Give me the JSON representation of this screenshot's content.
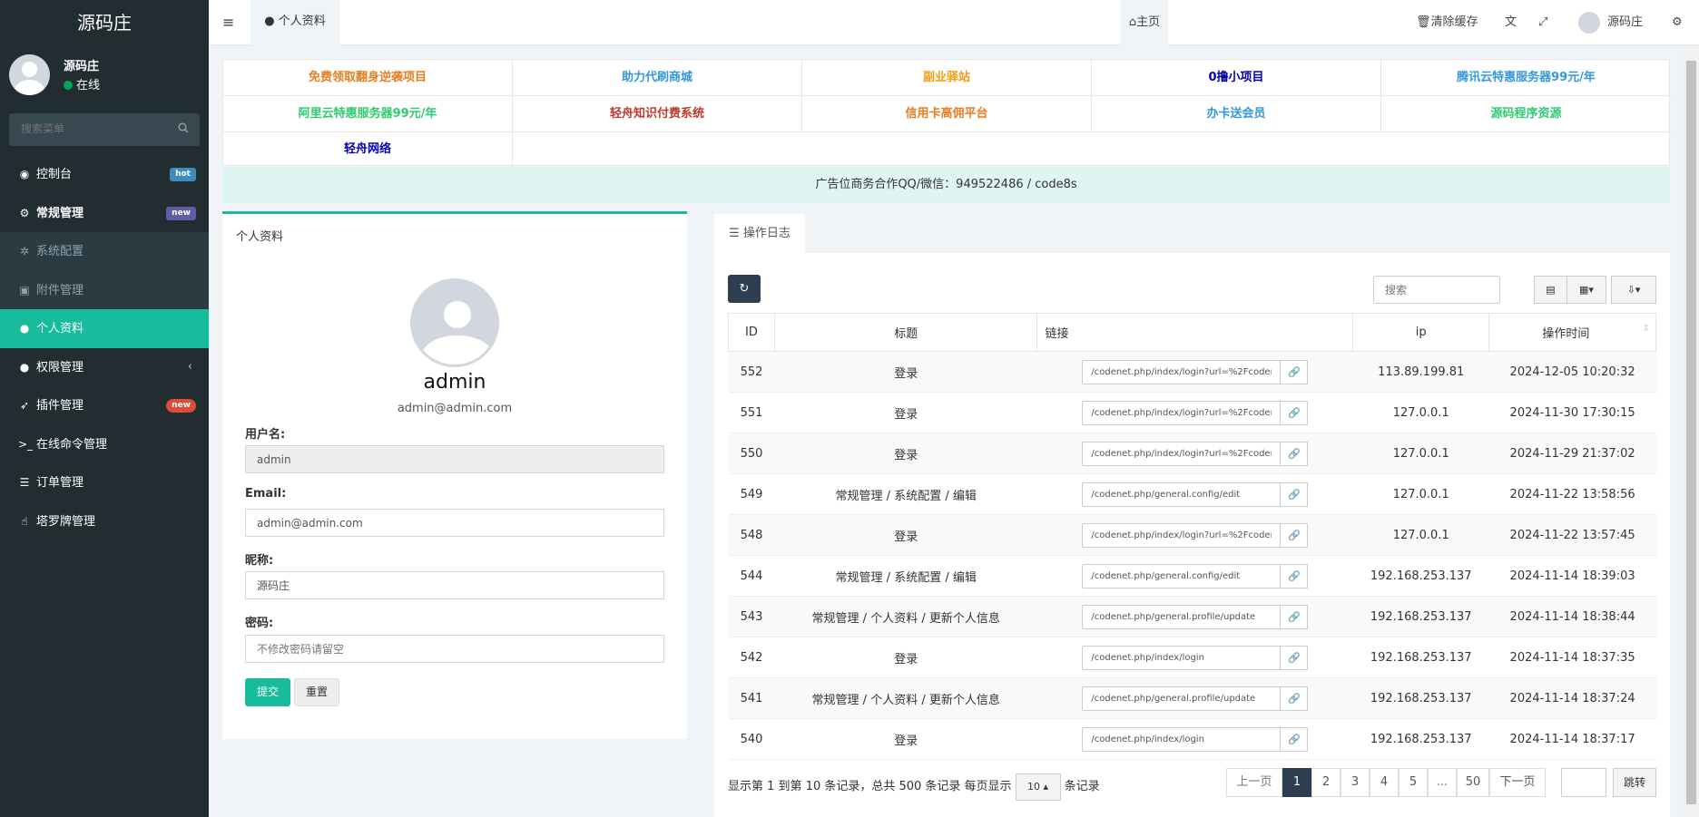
{
  "app": {
    "logo": "源码庄"
  },
  "user": {
    "name": "源码庄",
    "status": "在线"
  },
  "sidebar": {
    "search_placeholder": "搜索菜单",
    "items": [
      {
        "icon": "dashboard-icon",
        "glyph": "◉",
        "label": "控制台",
        "badge": "hot",
        "badge_color": "#3c8dbc"
      },
      {
        "icon": "cogs-icon",
        "glyph": "⚙",
        "label": "常规管理",
        "badge": "new",
        "badge_color": "#605ca8"
      },
      {
        "icon": "gear-icon",
        "glyph": "✲",
        "label": "系统配置"
      },
      {
        "icon": "image-icon",
        "glyph": "▣",
        "label": "附件管理"
      },
      {
        "icon": "user-icon",
        "glyph": "●",
        "label": "个人资料"
      },
      {
        "icon": "group-icon",
        "glyph": "●",
        "label": "权限管理"
      },
      {
        "icon": "rocket-icon",
        "glyph": "➶",
        "label": "插件管理",
        "badge": "new",
        "badge_color": "#dd4b39"
      },
      {
        "icon": "terminal-icon",
        "glyph": ">_",
        "label": "在线命令管理"
      },
      {
        "icon": "list-icon",
        "glyph": "☰",
        "label": "订单管理"
      },
      {
        "icon": "hand-icon",
        "glyph": "☝",
        "label": "塔罗牌管理"
      }
    ]
  },
  "header": {
    "active_tab": "个人资料",
    "home": "主页",
    "clear_cache": "清除缓存",
    "username": "源码庄"
  },
  "ads": {
    "row1": [
      {
        "text": "免费领取翻身逆袭项目",
        "color": "#e67e22"
      },
      {
        "text": "助力代刷商城",
        "color": "#3498db"
      },
      {
        "text": "副业驿站",
        "color": "#f39c12"
      },
      {
        "text": "0撸小项目",
        "color": "#0000aa"
      },
      {
        "text": "腾讯云特惠服务器99元/年",
        "color": "#3498db"
      }
    ],
    "row2": [
      {
        "text": "阿里云特惠服务器99元/年",
        "color": "#2ecc71"
      },
      {
        "text": "轻舟知识付费系统",
        "color": "#c0392b"
      },
      {
        "text": "信用卡高佣平台",
        "color": "#e67e22"
      },
      {
        "text": "办卡送会员",
        "color": "#3498db"
      },
      {
        "text": "源码程序资源",
        "color": "#2ecc71"
      }
    ],
    "row3": [
      {
        "text": "轻舟网络",
        "color": "#0000aa"
      }
    ],
    "notice": "广告位商务合作QQ/微信：949522486 / code8s"
  },
  "profile": {
    "title": "个人资料",
    "username_display": "admin",
    "email_display": "admin@admin.com",
    "label_username": "用户名:",
    "value_username": "admin",
    "label_email": "Email:",
    "value_email": "admin@admin.com",
    "label_nickname": "昵称:",
    "value_nickname": "源码庄",
    "label_password": "密码:",
    "placeholder_password": "不修改密码请留空",
    "submit": "提交",
    "reset": "重置"
  },
  "log": {
    "tab": "操作日志",
    "search_placeholder": "搜索",
    "columns": [
      "ID",
      "标题",
      "链接",
      "ip",
      "操作时间"
    ],
    "rows": [
      {
        "id": "552",
        "title": "登录",
        "url": "/codenet.php/index/login?url=%2Fcoden",
        "ip": "113.89.199.81",
        "time": "2024-12-05 10:20:32"
      },
      {
        "id": "551",
        "title": "登录",
        "url": "/codenet.php/index/login?url=%2Fcoden",
        "ip": "127.0.0.1",
        "time": "2024-11-30 17:30:15"
      },
      {
        "id": "550",
        "title": "登录",
        "url": "/codenet.php/index/login?url=%2Fcoden",
        "ip": "127.0.0.1",
        "time": "2024-11-29 21:37:02"
      },
      {
        "id": "549",
        "title": "常规管理 / 系统配置 / 编辑",
        "url": "/codenet.php/general.config/edit",
        "ip": "127.0.0.1",
        "time": "2024-11-22 13:58:56"
      },
      {
        "id": "548",
        "title": "登录",
        "url": "/codenet.php/index/login?url=%2Fcoden",
        "ip": "127.0.0.1",
        "time": "2024-11-22 13:57:45"
      },
      {
        "id": "544",
        "title": "常规管理 / 系统配置 / 编辑",
        "url": "/codenet.php/general.config/edit",
        "ip": "192.168.253.137",
        "time": "2024-11-14 18:39:03"
      },
      {
        "id": "543",
        "title": "常规管理 / 个人资料 / 更新个人信息",
        "url": "/codenet.php/general.profile/update",
        "ip": "192.168.253.137",
        "time": "2024-11-14 18:38:44"
      },
      {
        "id": "542",
        "title": "登录",
        "url": "/codenet.php/index/login",
        "ip": "192.168.253.137",
        "time": "2024-11-14 18:37:35"
      },
      {
        "id": "541",
        "title": "常规管理 / 个人资料 / 更新个人信息",
        "url": "/codenet.php/general.profile/update",
        "ip": "192.168.253.137",
        "time": "2024-11-14 18:37:24"
      },
      {
        "id": "540",
        "title": "登录",
        "url": "/codenet.php/index/login",
        "ip": "192.168.253.137",
        "time": "2024-11-14 18:37:17"
      }
    ],
    "info_prefix": "显示第 1 到第 10 条记录，总共 500 条记录 每页显示",
    "page_size": "10",
    "info_suffix": "条记录",
    "prev": "上一页",
    "next": "下一页",
    "pages": [
      "1",
      "2",
      "3",
      "4",
      "5",
      "...",
      "50"
    ],
    "jump": "跳转"
  },
  "colors": {
    "accent": "#18bc9c",
    "sidebar": "#222d32",
    "primary_dark": "#2c3e50"
  }
}
